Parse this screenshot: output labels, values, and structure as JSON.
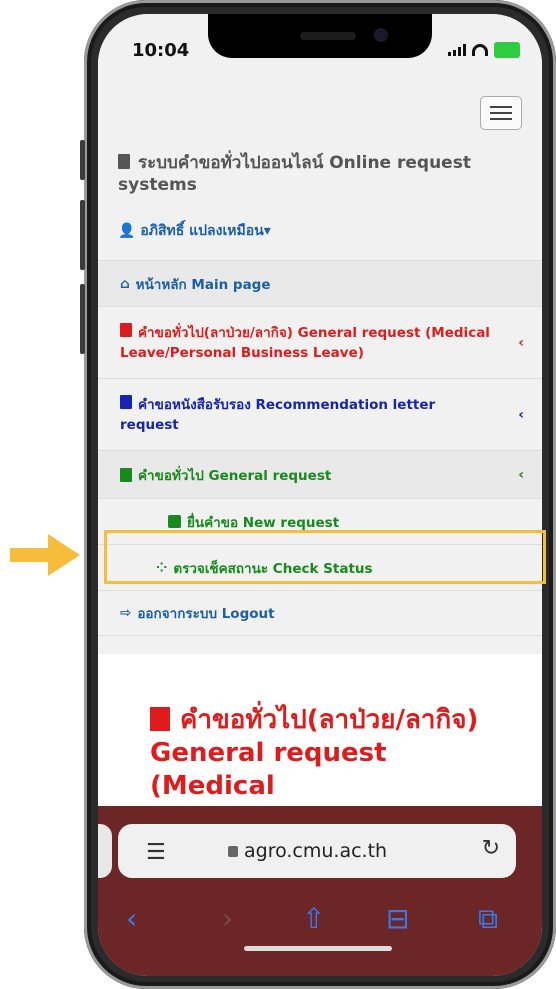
{
  "status_bar": {
    "time": "10:04"
  },
  "header": {
    "site_title": "ระบบคำขอทั่วไปออนไลน์ Online request systems",
    "user_name": "อภิสิทธิ์ แปลงเหมือน▾"
  },
  "menu": {
    "home": "หน้าหลัก Main page",
    "general_leave": "คำขอทั่วไป(ลาป่วย/ลากิจ) General request (Medical Leave/Personal Business Leave)",
    "recommendation": "คำขอหนังสือรับรอง Recommendation letter request",
    "general_request": "คำขอทั่วไป General request",
    "new_request": "ยื่นคำขอ New request",
    "check_status": "ตรวจเช็คสถานะ Check Status",
    "logout": "ออกจากระบบ Logout",
    "chevron": "‹"
  },
  "content": {
    "heading": "คำขอทั่วไป(ลาป่วย/ลากิจ) General request (Medical"
  },
  "browser": {
    "url": "agro.cmu.ac.th",
    "reader_icon": "reader-icon",
    "reload_icon": "↻"
  },
  "colors": {
    "highlight": "#f5bd3a",
    "red": "#e01b1b",
    "blue": "#1624b3",
    "green": "#168a1a"
  }
}
